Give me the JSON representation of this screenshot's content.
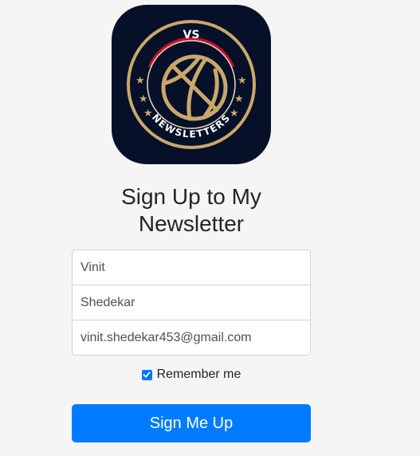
{
  "logo": {
    "top_text": "VS",
    "ring_text": "NEWSLETTERS"
  },
  "page": {
    "title": "Sign Up to My Newsletter"
  },
  "form": {
    "first_name": "Vinit",
    "last_name": "Shedekar",
    "email": "vinit.shedekar453@gmail.com",
    "remember_label": "Remember me",
    "remember_checked": true,
    "submit_label": "Sign Me Up"
  },
  "colors": {
    "accent": "#007bff",
    "logo_bg": "#061029",
    "logo_gold": "#c9a86a",
    "logo_red": "#c8102e"
  },
  "icons": [
    "basketball-icon",
    "star-icon",
    "checkbox-checked-icon"
  ]
}
